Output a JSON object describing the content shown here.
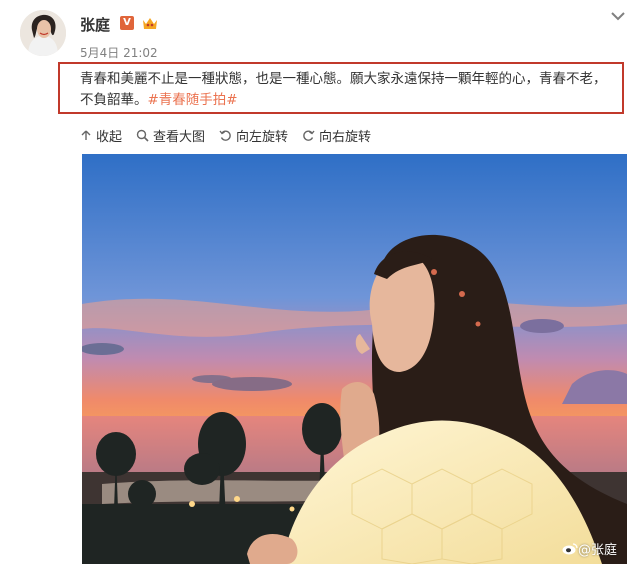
{
  "post": {
    "username": "张庭",
    "v_badge": "V",
    "timestamp": "5月4日 21:02",
    "text": "青春和美麗不止是一種狀態，也是一種心態。願大家永遠保持一顆年輕的心，青春不老，不負韶華。",
    "hashtag": "#青春随手拍#"
  },
  "toolbar": {
    "items": [
      {
        "label": "收起",
        "icon": "collapse-icon"
      },
      {
        "label": "查看大图",
        "icon": "magnify-icon"
      },
      {
        "label": "向左旋转",
        "icon": "rotate-left-icon"
      },
      {
        "label": "向右旋转",
        "icon": "rotate-right-icon"
      }
    ]
  },
  "photo": {
    "watermark": "@张庭",
    "description": "sunset-beach-woman-photo"
  },
  "colors": {
    "highlight_border": "#c1392b",
    "hashtag": "#eb7350",
    "badge": "#e0653a"
  }
}
